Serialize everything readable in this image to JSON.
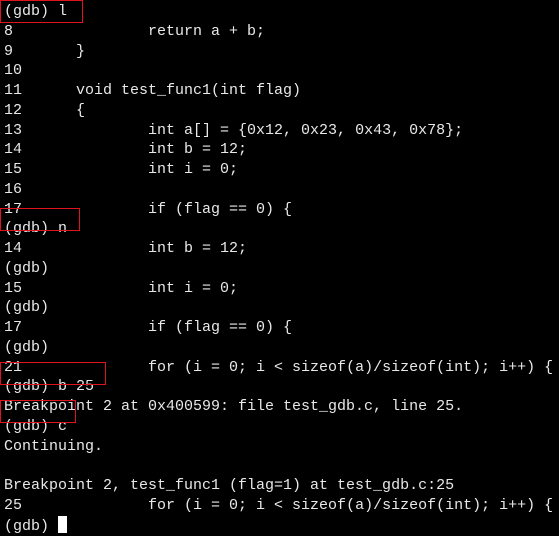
{
  "terminal": {
    "lines": [
      "(gdb) l",
      "8\t\treturn a + b;",
      "9\t}",
      "10",
      "11\tvoid test_func1(int flag)",
      "12\t{",
      "13\t\tint a[] = {0x12, 0x23, 0x43, 0x78};",
      "14\t\tint b = 12;",
      "15\t\tint i = 0;",
      "16",
      "17\t\tif (flag == 0) {",
      "(gdb) n",
      "14\t\tint b = 12;",
      "(gdb)",
      "15\t\tint i = 0;",
      "(gdb)",
      "17\t\tif (flag == 0) {",
      "(gdb)",
      "21\t\tfor (i = 0; i < sizeof(a)/sizeof(int); i++) {",
      "(gdb) b 25",
      "Breakpoint 2 at 0x400599: file test_gdb.c, line 25.",
      "(gdb) c",
      "Continuing.",
      "",
      "Breakpoint 2, test_func1 (flag=1) at test_gdb.c:25",
      "25\t\tfor (i = 0; i < sizeof(a)/sizeof(int); i++) {",
      "(gdb) "
    ],
    "highlight_color": "#e0141e"
  }
}
